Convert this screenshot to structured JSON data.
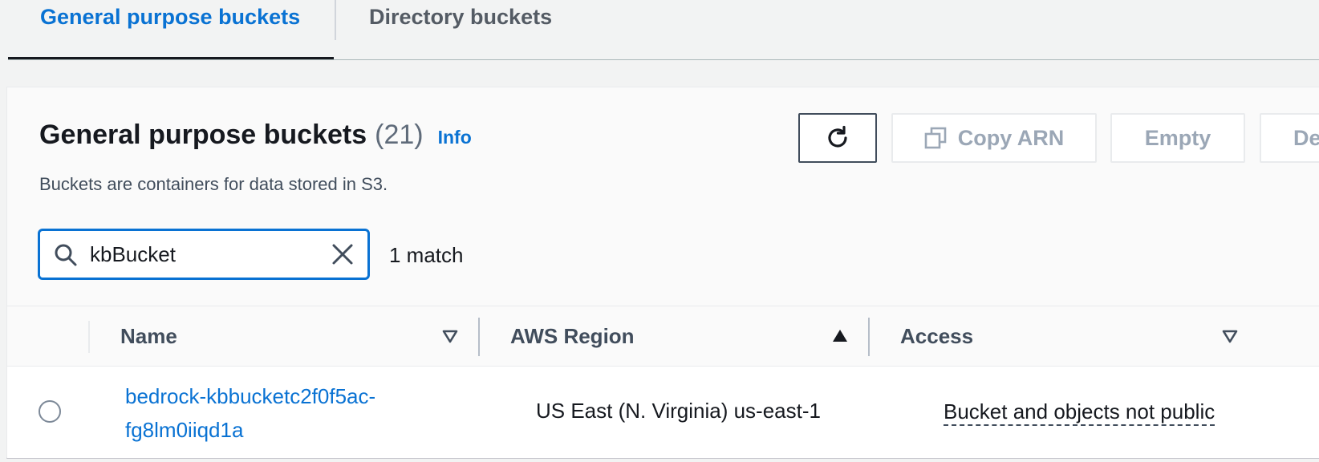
{
  "tabs": [
    {
      "label": "General purpose buckets",
      "active": true
    },
    {
      "label": "Directory buckets",
      "active": false
    }
  ],
  "header": {
    "title": "General purpose buckets",
    "count": "(21)",
    "info_label": "Info",
    "description": "Buckets are containers for data stored in S3."
  },
  "actions": {
    "refresh_icon": "refresh-icon",
    "copy_arn_label": "Copy ARN",
    "copy_icon": "copy-icon",
    "empty_label": "Empty",
    "delete_label": "De"
  },
  "search": {
    "value": "kbBucket",
    "placeholder": "",
    "match_text": "1 match"
  },
  "table": {
    "columns": [
      {
        "label": "Name",
        "sort": "none"
      },
      {
        "label": "AWS Region",
        "sort": "ascending"
      },
      {
        "label": "Access",
        "sort": "none"
      }
    ],
    "rows": [
      {
        "name": "bedrock-kbbucketc2f0f5ac-fg8lm0iiqd1a",
        "region": "US East (N. Virginia) us-east-1",
        "access": "Bucket and objects not public"
      }
    ]
  },
  "colors": {
    "link": "#0972d3",
    "text": "#16191f",
    "disabled": "#9ba7b6",
    "background": "#f2f3f3"
  }
}
